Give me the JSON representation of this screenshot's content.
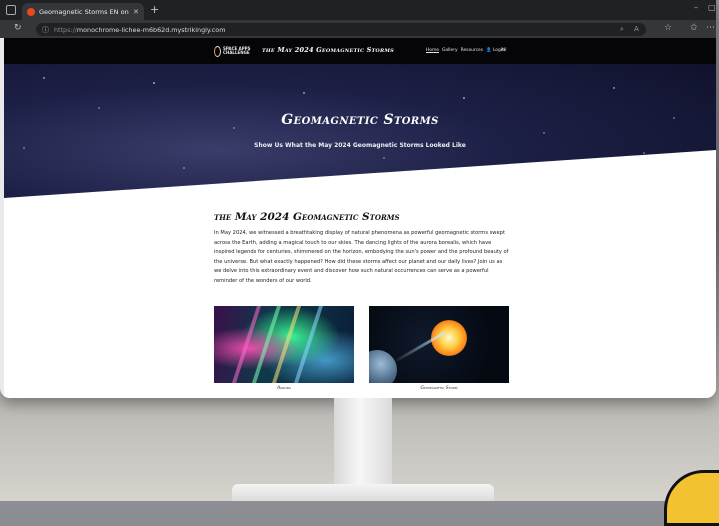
{
  "browser": {
    "tab_title": "Geomagnetic Storms EN on Strik",
    "tab_close": "✕",
    "new_tab": "+",
    "url_protocol": "https://",
    "url_host": "monochrome-lichee-m6b62d.mystrikingly.com"
  },
  "site": {
    "logo_text": "SPACE APPS CHALLENGE",
    "title": "the May 2024 Geomagnetic Storms",
    "menu": [
      "Home",
      "Gallery",
      "Resources",
      "Login",
      "All"
    ]
  },
  "hero": {
    "title": "Geomagnetic Storms",
    "subtitle": "Show Us What the May 2024 Geomagnetic Storms Looked Like"
  },
  "section": {
    "title": "the May 2024 Geomagnetic Storms",
    "body": "In May 2024, we witnessed a breathtaking display of natural phenomena as powerful geomagnetic storms swept across the Earth, adding a magical touch to our skies. The dancing lights of the aurora borealis, which have inspired legends for centuries, shimmered on the horizon, embodying the sun's power and the profound beauty of the universe. But what exactly happened? How did these storms affect our planet and our daily lives? Join us as we delve into this extraordinary event and discover how such natural occurrences can serve as a powerful reminder of the wonders of our world."
  },
  "gallery": [
    {
      "caption": "Aurora"
    },
    {
      "caption": "Geomagnetic Storm"
    }
  ],
  "colors": {
    "nav_bg": "#050508",
    "hero_bg": "#1d2046",
    "browser_bg": "#202124"
  }
}
